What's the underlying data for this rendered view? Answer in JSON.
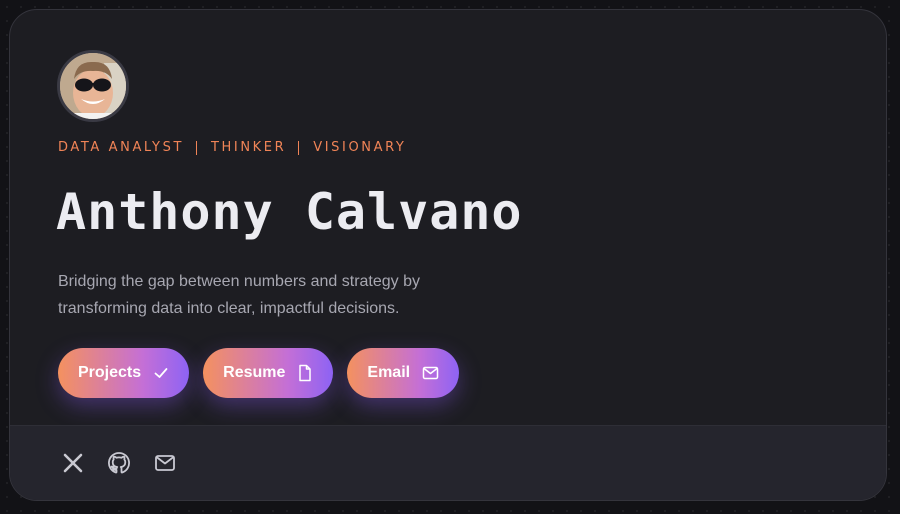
{
  "profile": {
    "roles": [
      "DATA ANALYST",
      "THINKER",
      "VISIONARY"
    ],
    "name": "Anthony Calvano",
    "tagline": "Bridging the gap between numbers and strategy by transforming data into clear, impactful decisions."
  },
  "buttons": {
    "projects": {
      "label": "Projects",
      "icon": "check-icon"
    },
    "resume": {
      "label": "Resume",
      "icon": "document-icon"
    },
    "email": {
      "label": "Email",
      "icon": "mail-icon"
    }
  },
  "social": [
    {
      "icon": "x-twitter-icon"
    },
    {
      "icon": "github-icon"
    },
    {
      "icon": "mail-icon"
    }
  ],
  "colors": {
    "accent": "#f08457",
    "gradient_start": "#f4915f",
    "gradient_end": "#8e63f4",
    "card_bg": "#1d1d22",
    "footer_bg": "#25252d"
  }
}
